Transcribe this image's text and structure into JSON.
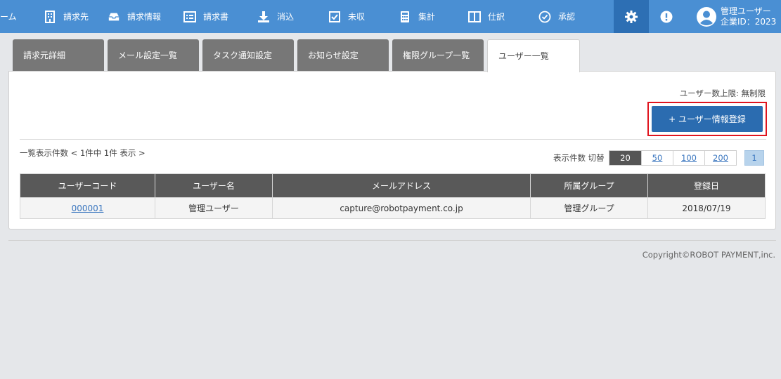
{
  "nav": {
    "items": [
      {
        "label": "ーム",
        "icon": "home-icon"
      },
      {
        "label": "請求先",
        "icon": "building-icon"
      },
      {
        "label": "請求情報",
        "icon": "inbox-icon"
      },
      {
        "label": "請求書",
        "icon": "list-icon"
      },
      {
        "label": "消込",
        "icon": "download-icon"
      },
      {
        "label": "未収",
        "icon": "checkbox-icon"
      },
      {
        "label": "集計",
        "icon": "calculator-icon"
      },
      {
        "label": "仕訳",
        "icon": "columns-icon"
      },
      {
        "label": "承認",
        "icon": "check-circle-icon"
      }
    ],
    "settings_icon": "gear-icon",
    "alert_icon": "exclamation-icon",
    "user": {
      "name": "管理ユーザー",
      "company": "企業ID：2023"
    }
  },
  "tabs": [
    {
      "label": "請求元詳細"
    },
    {
      "label": "メール設定一覧"
    },
    {
      "label": "タスク通知設定"
    },
    {
      "label": "お知らせ設定"
    },
    {
      "label": "権限グループ一覧"
    },
    {
      "label": "ユーザー一覧"
    }
  ],
  "panel": {
    "user_limit": "ユーザー数上限: 無制限",
    "add_button": "+ ユーザー情報登録",
    "count_text": "一覧表示件数 < 1件中 1件 表示 >",
    "per_page_label": "表示件数 切替",
    "per_page_options": [
      "20",
      "50",
      "100",
      "200"
    ],
    "per_page_selected": "20",
    "current_page": "1"
  },
  "table": {
    "headers": [
      "ユーザーコード",
      "ユーザー名",
      "メールアドレス",
      "所属グループ",
      "登録日"
    ],
    "rows": [
      {
        "code": "000001",
        "name": "管理ユーザー",
        "email": "capture@robotpayment.co.jp",
        "group": "管理グループ",
        "date": "2018/07/19"
      }
    ]
  },
  "footer": {
    "copyright": "Copyright©ROBOT PAYMENT,inc."
  },
  "colors": {
    "topbar": "#4a8fd3",
    "accent": "#2b6cb0",
    "highlight": "#e0141e",
    "table_header": "#595959"
  }
}
